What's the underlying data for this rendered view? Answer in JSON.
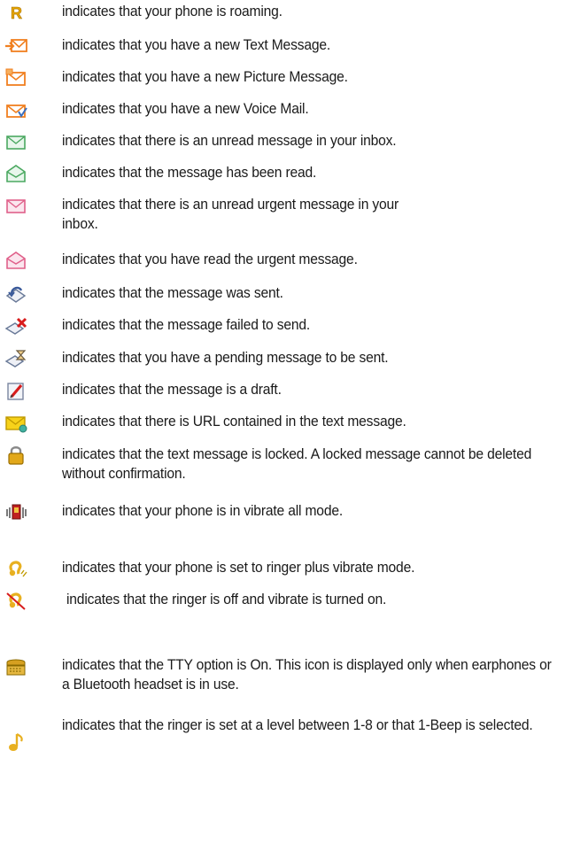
{
  "items": [
    {
      "icon": "roaming-icon",
      "text": "indicates that your phone is roaming."
    },
    {
      "icon": "new-text-message-icon",
      "text": "indicates that you have a new Text Message."
    },
    {
      "icon": "new-picture-message-icon",
      "text": "indicates that you have a new Picture Message."
    },
    {
      "icon": "new-voice-mail-icon",
      "text": "indicates that you have a new Voice Mail."
    },
    {
      "icon": "unread-message-icon",
      "text": "indicates that there is an unread message in your inbox."
    },
    {
      "icon": "read-message-icon",
      "text": "indicates that the message has been read."
    },
    {
      "icon": "unread-urgent-message-icon",
      "text": "indicates that there is an unread urgent message in your inbox."
    },
    {
      "icon": "read-urgent-message-icon",
      "text": "indicates that you have read the urgent message."
    },
    {
      "icon": "message-sent-icon",
      "text": "indicates that the message was sent."
    },
    {
      "icon": "message-failed-icon",
      "text": "indicates that the message failed to send."
    },
    {
      "icon": "message-pending-icon",
      "text": "indicates that you have a pending message to be sent."
    },
    {
      "icon": "message-draft-icon",
      "text": "indicates that the message is a draft."
    },
    {
      "icon": "message-url-icon",
      "text": "indicates that there is URL contained in the text message."
    },
    {
      "icon": "message-locked-icon",
      "text": "indicates that the text message is locked. A locked message cannot be deleted without confirmation."
    },
    {
      "icon": "vibrate-all-icon",
      "text": "indicates that your phone is in vibrate all mode."
    },
    {
      "icon": "ringer-plus-vibrate-icon",
      "text": "indicates that your phone is set to ringer plus vibrate mode."
    },
    {
      "icon": "ringer-off-vibrate-on-icon",
      "text": "indicates that the ringer is off and vibrate is turned on."
    },
    {
      "icon": "tty-icon",
      "text": "indicates that the TTY option is On. This icon is displayed only when earphones or a Bluetooth headset is in use."
    },
    {
      "icon": "ringer-level-icon",
      "text": "indicates that the ringer is set at a level between 1-8 or that 1-Beep is selected."
    }
  ],
  "colors": {
    "roaming": "#e8a800",
    "envelope_orange": "#f08020",
    "envelope_green": "#4aa860",
    "envelope_pink": "#e0608a",
    "sent_blue": "#3a5a9a",
    "failed_red": "#d81c1c",
    "lock_gold": "#e2a81a",
    "tty": "#d6a020"
  }
}
